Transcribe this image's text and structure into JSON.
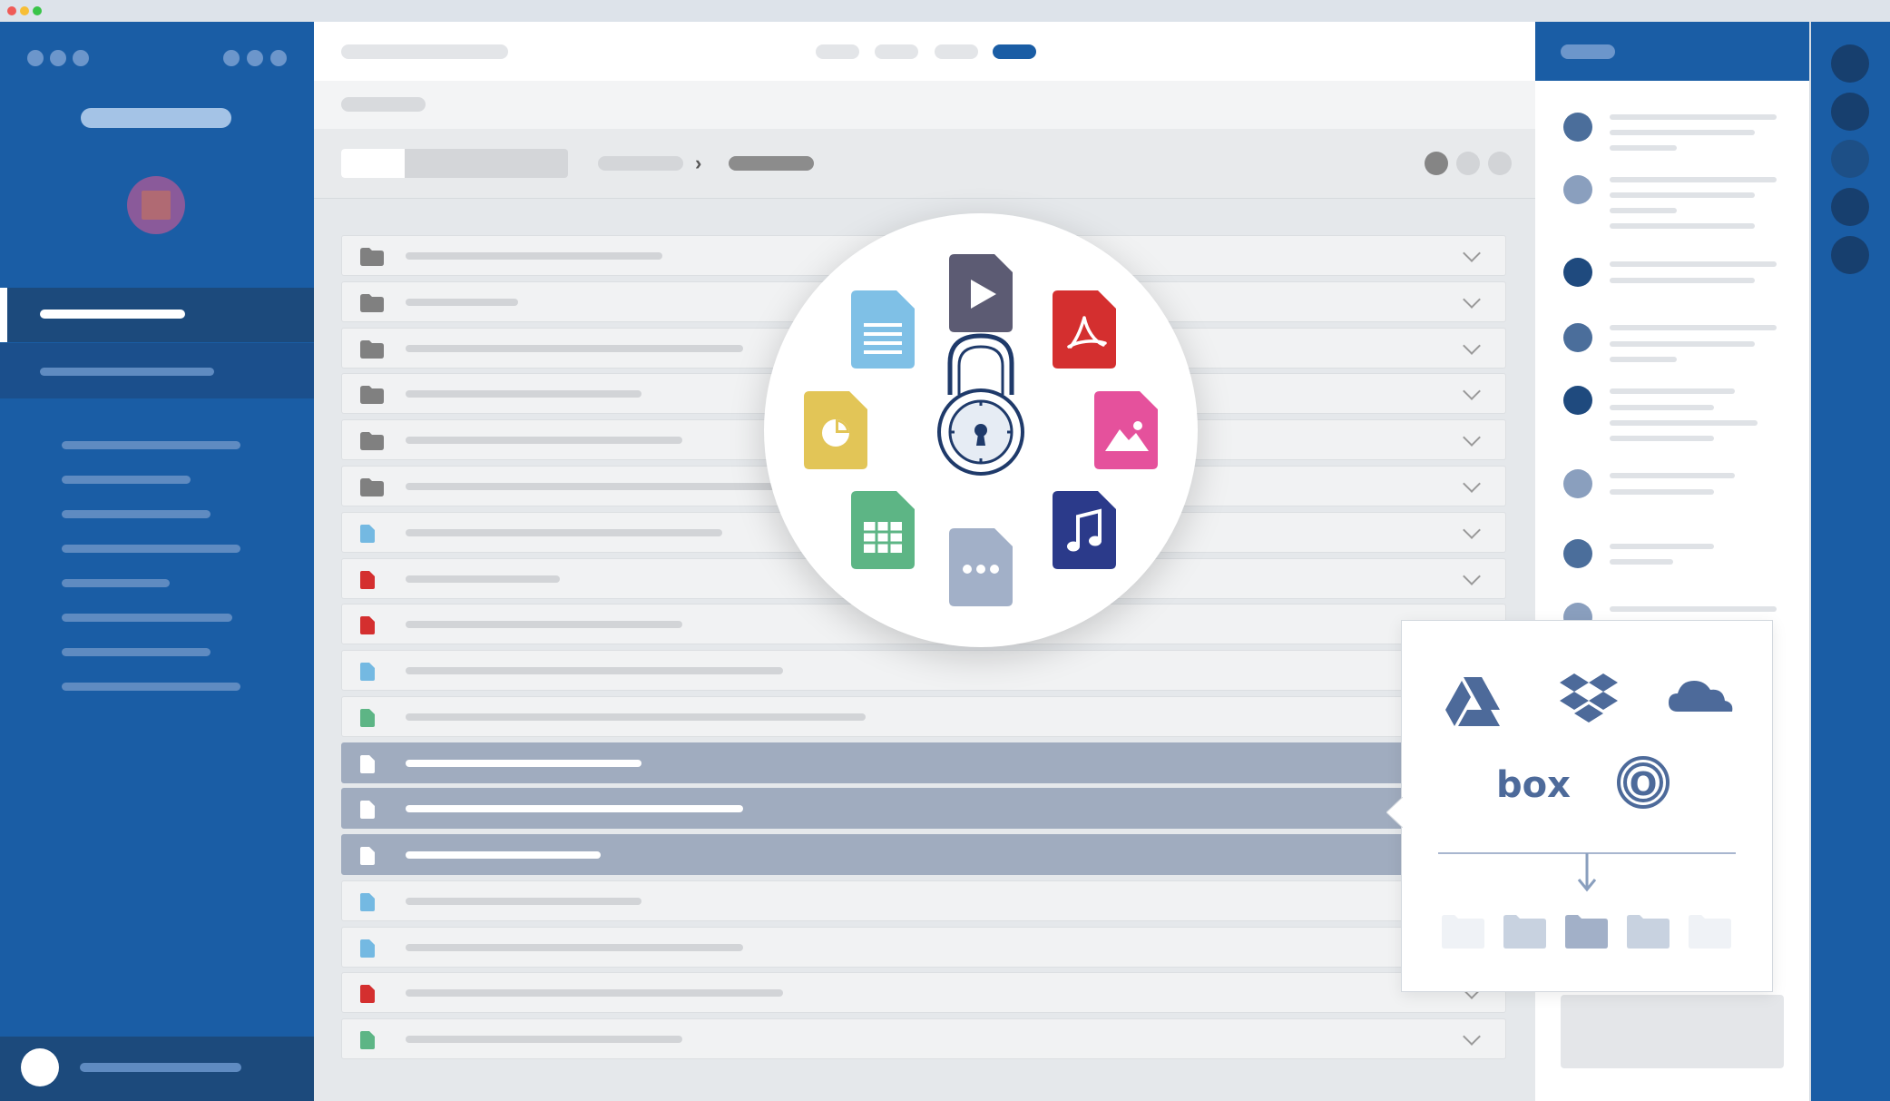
{
  "window": {
    "traffic_lights": [
      "#ef5b57",
      "#f7be36",
      "#39c448"
    ]
  },
  "colors": {
    "sidebar_blue": "#1a5da5",
    "selection_gray": "#a0acbf",
    "accent_blue": "#1a5da5"
  },
  "sidebar": {
    "profile_icon": "user-avatar-icon",
    "nav_item_count": 10
  },
  "main": {
    "view_tabs_active_index": 3,
    "view_tab_count": 4,
    "breadcrumb_separator": "›",
    "file_rows": [
      {
        "kind": "folder"
      },
      {
        "kind": "folder"
      },
      {
        "kind": "folder"
      },
      {
        "kind": "folder"
      },
      {
        "kind": "folder"
      },
      {
        "kind": "folder"
      },
      {
        "kind": "document",
        "color": "#74b9e2"
      },
      {
        "kind": "pdf",
        "color": "#d42f2f"
      },
      {
        "kind": "pdf",
        "color": "#d42f2f"
      },
      {
        "kind": "document",
        "color": "#74b9e2"
      },
      {
        "kind": "spreadsheet",
        "color": "#5db585"
      },
      {
        "kind": "file",
        "selected": true
      },
      {
        "kind": "file",
        "selected": true
      },
      {
        "kind": "file",
        "selected": true
      },
      {
        "kind": "document",
        "color": "#74b9e2"
      },
      {
        "kind": "document",
        "color": "#74b9e2"
      },
      {
        "kind": "pdf",
        "color": "#d42f2f"
      },
      {
        "kind": "spreadsheet",
        "color": "#5db585"
      }
    ]
  },
  "encryption_badge": {
    "center_icon": "padlock-icon",
    "file_types": [
      {
        "icon": "video-file-icon",
        "color": "#5c5b73"
      },
      {
        "icon": "pdf-file-icon",
        "color": "#d42f2f"
      },
      {
        "icon": "image-file-icon",
        "color": "#e5519c"
      },
      {
        "icon": "audio-file-icon",
        "color": "#2b3a8a"
      },
      {
        "icon": "other-file-icon",
        "color": "#a2b0c8"
      },
      {
        "icon": "spreadsheet-file-icon",
        "color": "#5db585"
      },
      {
        "icon": "presentation-file-icon",
        "color": "#e2c557"
      },
      {
        "icon": "document-file-icon",
        "color": "#7fc0e6"
      }
    ]
  },
  "cloud_popup": {
    "providers": [
      "google-drive-icon",
      "dropbox-icon",
      "onedrive-icon",
      "box-icon",
      "owncloud-icon"
    ],
    "box_label": "box",
    "owncloud_label": "O",
    "folder_count": 5
  },
  "activity_panel": {
    "avatar_colors": [
      "#4b6e9b",
      "#8a9fbe",
      "#1f4a7e",
      "#4b6e9b",
      "#1f4a7e",
      "#8a9fbe",
      "#4b6e9b",
      "#8a9fbe"
    ]
  },
  "account_strip": {
    "account_colors": [
      "#173f6e",
      "#173f6e",
      "#1d4f86",
      "#173f6e",
      "#173f6e"
    ]
  }
}
